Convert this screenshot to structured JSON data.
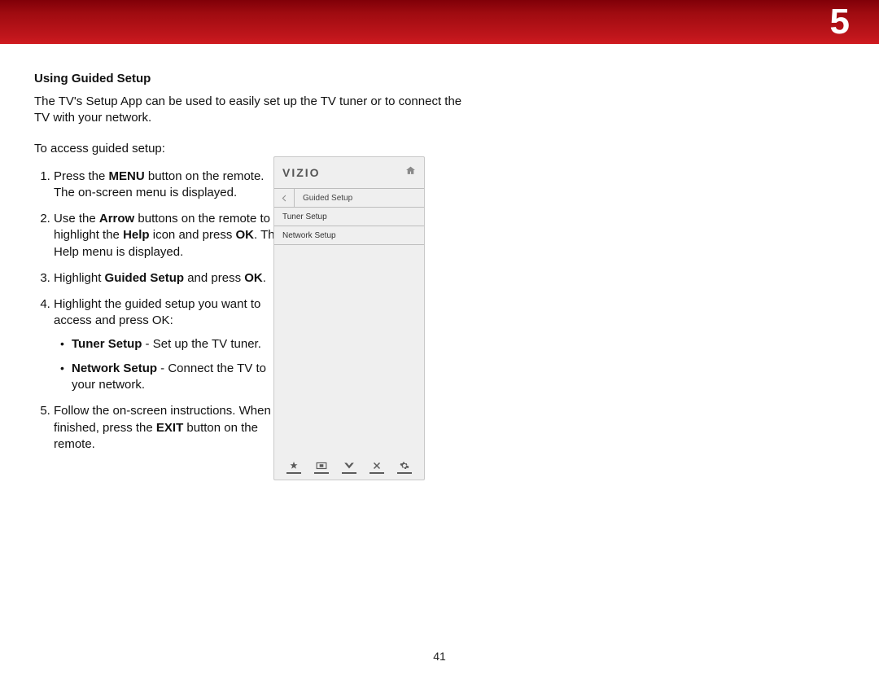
{
  "header": {
    "chapter_number": "5"
  },
  "section": {
    "title": "Using Guided Setup",
    "intro": "The TV's Setup App can be used to easily set up the TV tuner or to connect the TV with your network.",
    "lead": "To access guided setup:"
  },
  "steps": {
    "s1_a": "Press the ",
    "s1_b": "MENU",
    "s1_c": " button on the remote. The on-screen menu is displayed.",
    "s2_a": "Use the ",
    "s2_b": "Arrow",
    "s2_c": " buttons on the remote to highlight the ",
    "s2_d": "Help",
    "s2_e": " icon and press ",
    "s2_f": "OK",
    "s2_g": ". The Help menu is displayed.",
    "s3_a": "Highlight ",
    "s3_b": "Guided Setup",
    "s3_c": " and press ",
    "s3_d": "OK",
    "s3_e": ".",
    "s4": "Highlight the guided setup you want to access and press OK:",
    "s4_b1_a": "Tuner Setup",
    "s4_b1_b": " - Set up the TV tuner.",
    "s4_b2_a": "Network Setup",
    "s4_b2_b": " - Connect the TV to your network.",
    "s5_a": "Follow the on-screen instructions. When finished, press the ",
    "s5_b": "EXIT",
    "s5_c": " button on the remote."
  },
  "tv_menu": {
    "brand": "VIZIO",
    "breadcrumb": "Guided Setup",
    "items": [
      "Tuner Setup",
      "Network Setup"
    ]
  },
  "page_number": "41"
}
